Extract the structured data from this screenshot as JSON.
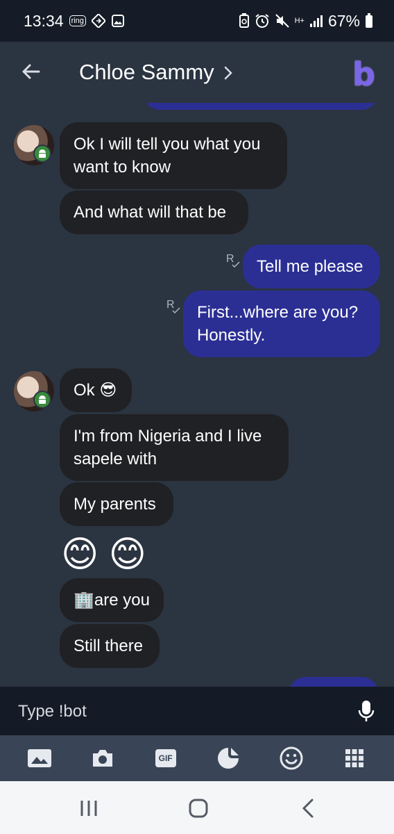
{
  "status_bar": {
    "time": "13:34",
    "ring_label": "ring",
    "battery": "67%",
    "network": "H+"
  },
  "header": {
    "contact_name": "Chloe Sammy",
    "logo_letter": "b"
  },
  "messages": [
    {
      "direction": "in",
      "text": "Ok I will tell you what you want to know"
    },
    {
      "direction": "in",
      "text": "And what will that be"
    },
    {
      "direction": "out",
      "text": "Tell me please",
      "read": "R"
    },
    {
      "direction": "out",
      "text": "First...where are you? Honestly.",
      "read": "R"
    },
    {
      "direction": "in",
      "text": "Ok 😎"
    },
    {
      "direction": "in",
      "text": "I'm from Nigeria and I live sapele with"
    },
    {
      "direction": "in",
      "text": "My parents"
    },
    {
      "direction": "in",
      "text": "😊 😊"
    },
    {
      "direction": "in",
      "text": "🏢are you"
    },
    {
      "direction": "in",
      "text": "Still there"
    }
  ],
  "composer": {
    "placeholder": "Type !bot"
  },
  "toolbar": {
    "gif_label": "GIF",
    "icons": [
      "gallery-icon",
      "camera-icon",
      "gif-icon",
      "sticker-icon",
      "emoji-icon",
      "apps-grid-icon"
    ]
  },
  "colors": {
    "background": "#2b3441",
    "incoming_bubble": "#202124",
    "outgoing_bubble": "#2b2f94",
    "status_bar": "#151c27",
    "toolbar": "#394556",
    "logo": "#7b66e8"
  }
}
